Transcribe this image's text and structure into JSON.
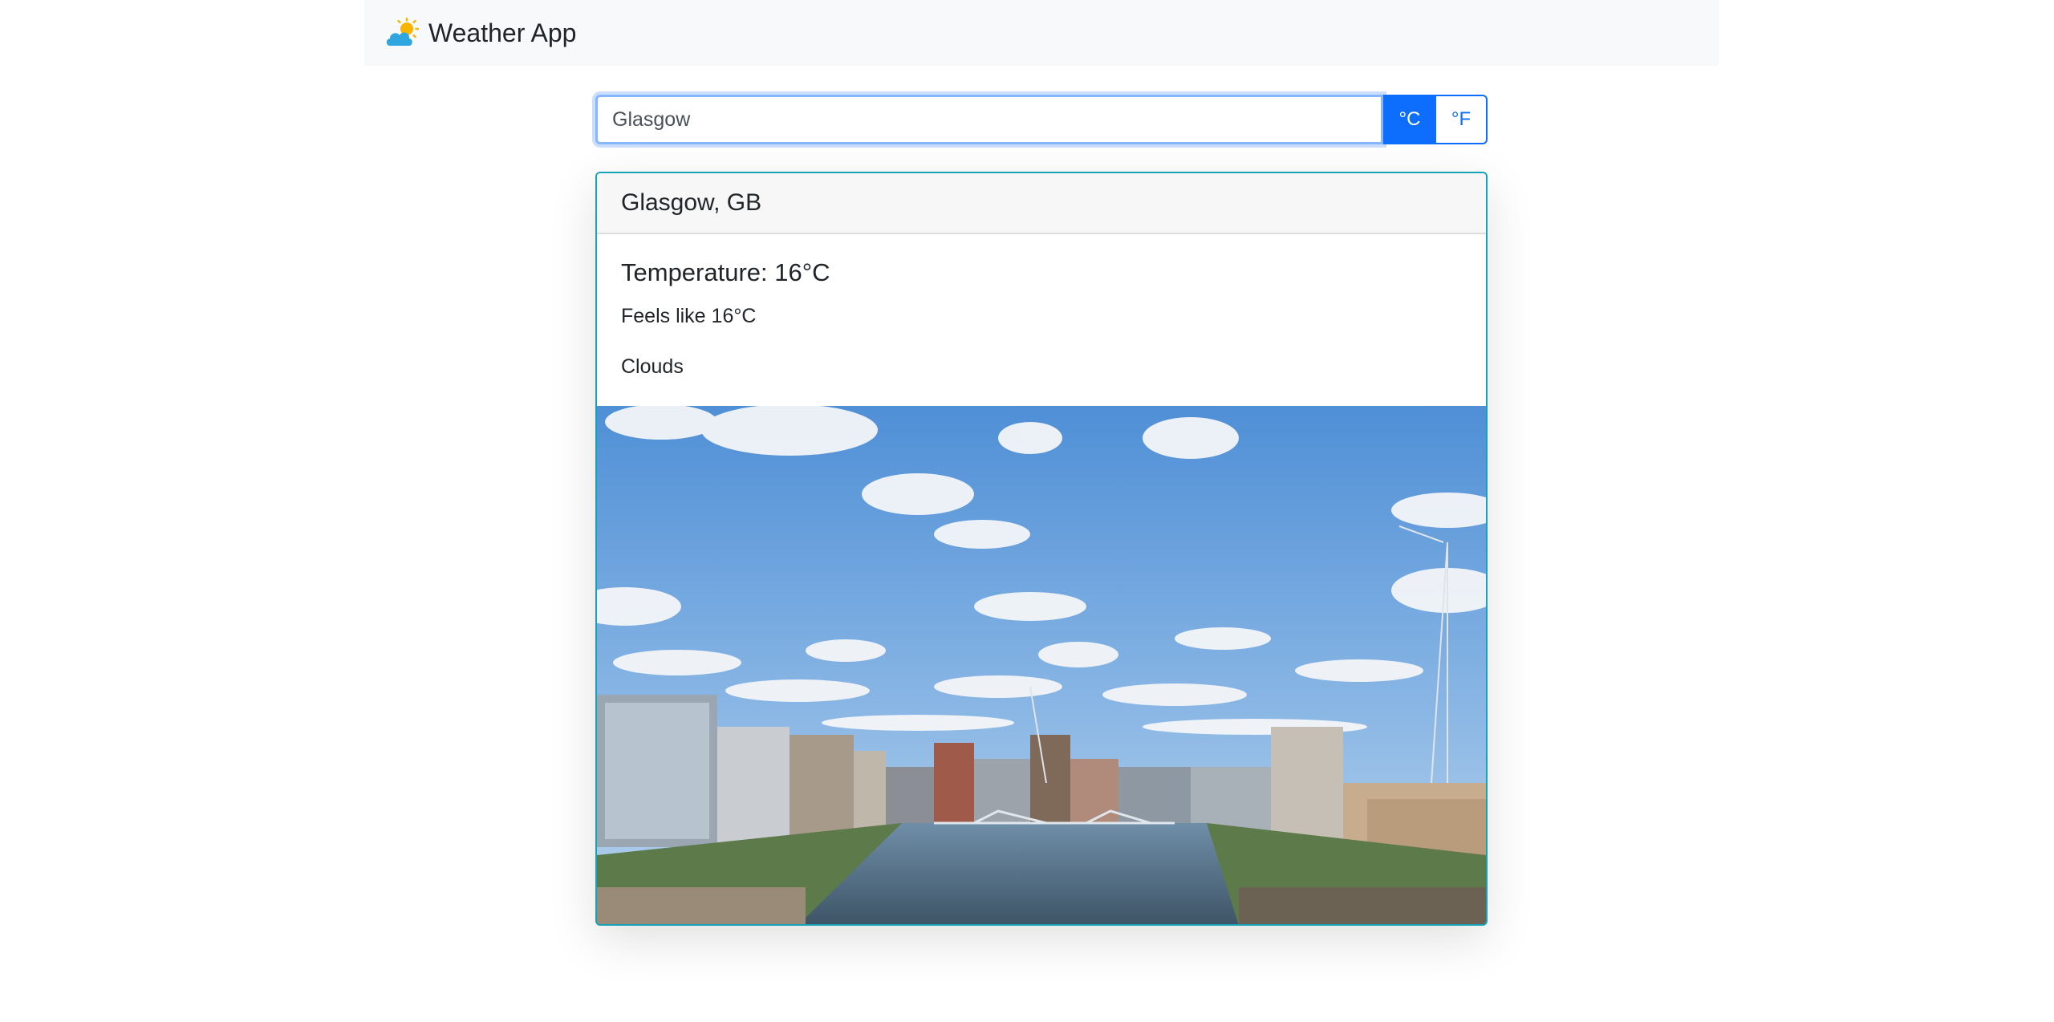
{
  "navbar": {
    "brand_icon": "sun-behind-cloud-icon",
    "brand_title": "Weather App"
  },
  "search": {
    "value": "Glasgow",
    "placeholder": ""
  },
  "units": {
    "celsius_label": "°C",
    "fahrenheit_label": "°F",
    "selected": "°C"
  },
  "weather": {
    "location": "Glasgow, GB",
    "temperature": "Temperature: 16°C",
    "feels_like": "Feels like 16°C",
    "condition": "Clouds"
  },
  "colors": {
    "accent": "#0d6efd",
    "card_border": "#17a2b8",
    "navbar_bg": "#f8f9fa"
  }
}
